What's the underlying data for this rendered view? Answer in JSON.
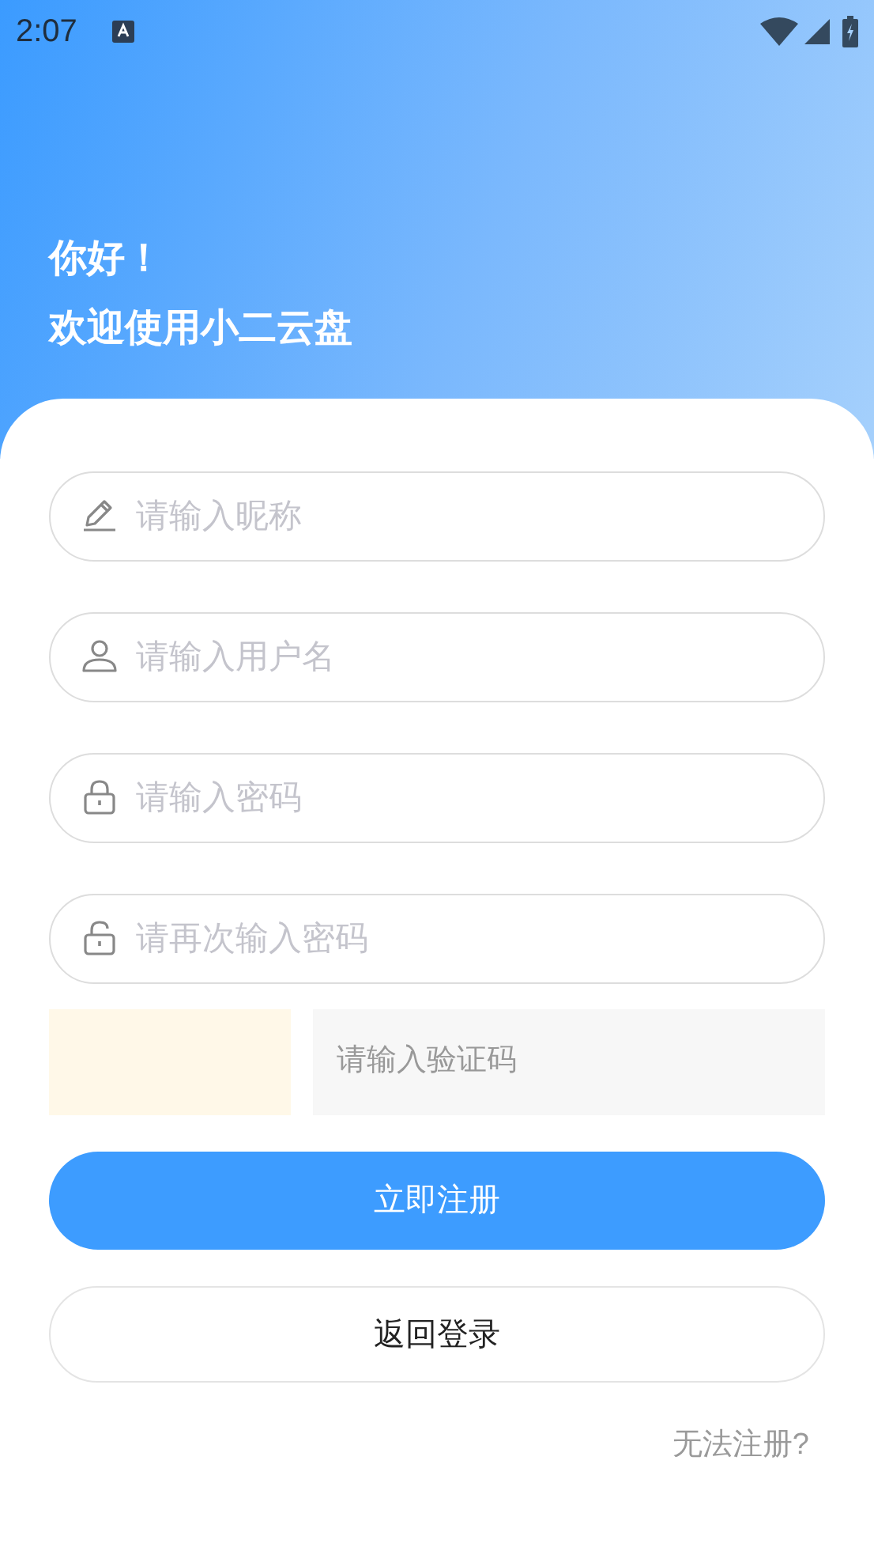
{
  "status_bar": {
    "time": "2:07"
  },
  "greeting": {
    "line_1": "你好！",
    "line_2": "欢迎使用小二云盘"
  },
  "fields": [
    {
      "kind": "pencil",
      "placeholder": "请输入昵称"
    },
    {
      "kind": "person",
      "placeholder": "请输入用户名"
    },
    {
      "kind": "lock",
      "placeholder": "请输入密码"
    },
    {
      "kind": "unlock",
      "placeholder": "请再次输入密码"
    }
  ],
  "captcha": {
    "placeholder": "请输入验证码"
  },
  "buttons": [
    {
      "kind": "primary",
      "label": "立即注册"
    },
    {
      "kind": "outline",
      "label": "返回登录"
    }
  ],
  "help_link": "无法注册?"
}
